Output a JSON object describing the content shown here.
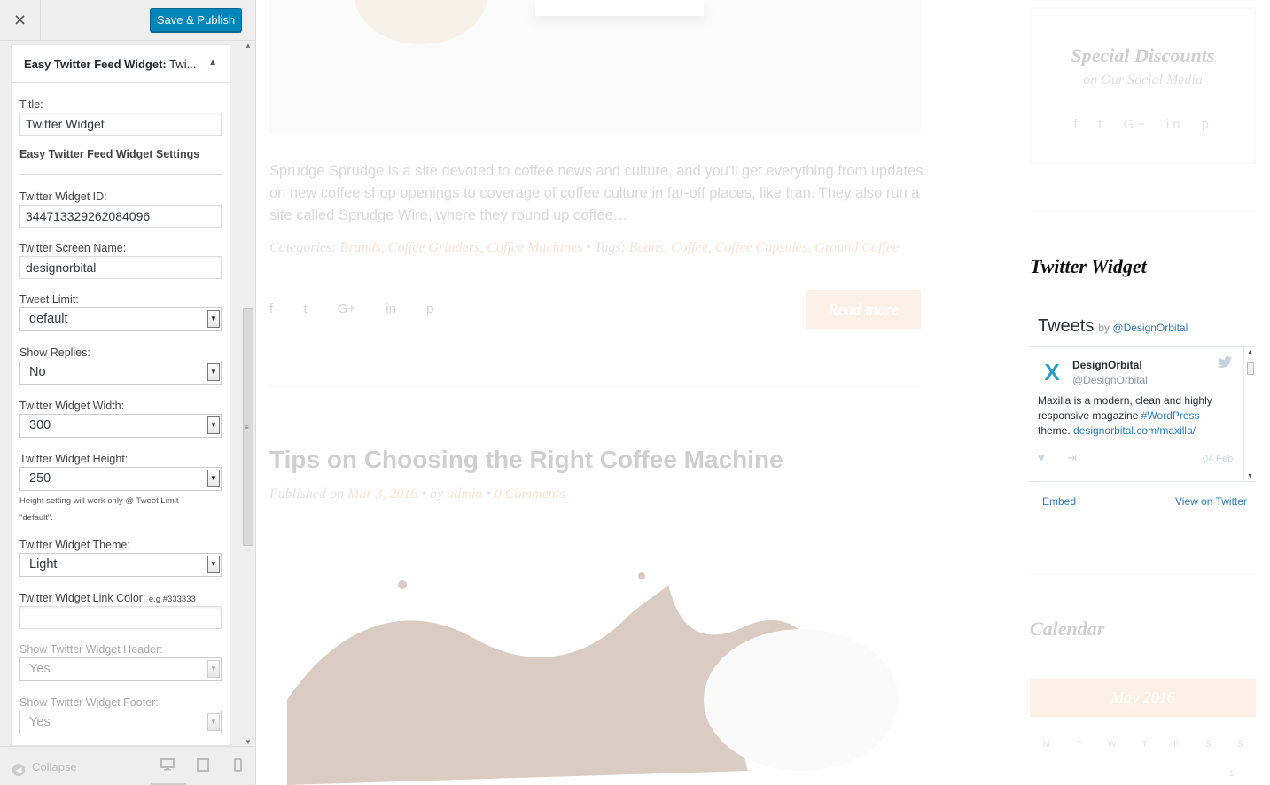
{
  "header": {
    "close_label": "×",
    "publish_label": "Save & Publish"
  },
  "widget": {
    "title_bold": "Easy Twitter Feed Widget:",
    "title_rest": " Twi...",
    "toggle_icon": "▲",
    "fields": {
      "title_label": "Title:",
      "title_value": "Twitter Widget",
      "settings_heading": "Easy Twitter Feed Widget Settings",
      "widget_id_label": "Twitter Widget ID:",
      "widget_id_value": "344713329262084096",
      "screen_name_label": "Twitter Screen Name:",
      "screen_name_value": "designorbital",
      "tweet_limit_label": "Tweet Limit:",
      "tweet_limit_value": "default",
      "show_replies_label": "Show Replies:",
      "show_replies_value": "No",
      "width_label": "Twitter Widget Width:",
      "width_value": "300",
      "height_label": "Twitter Widget Height:",
      "height_value": "250",
      "height_note_1": "Height setting will work only @ Tweet Limit",
      "height_note_2": "\"default\".",
      "theme_label": "Twitter Widget Theme:",
      "theme_value": "Light",
      "link_color_label": "Twitter Widget Link Color:",
      "link_color_hint": "e.g #333333",
      "link_color_value": "",
      "show_header_label": "Show Twitter Widget Header:",
      "show_header_value": "Yes",
      "show_footer_label": "Show Twitter Widget Footer:",
      "show_footer_value": "Yes"
    }
  },
  "footer": {
    "collapse_label": "Collapse",
    "collapse_icon": "◀",
    "devices": [
      "desktop-icon",
      "tablet-icon",
      "mobile-icon"
    ]
  },
  "preview": {
    "excerpt": "Sprudge Sprudge is a site devoted to coffee news and culture, and you'll get everything from updates on new coffee shop openings to coverage of coffee culture in far-off places, like Iran. They also run a site called Sprudge Wire, where they round up coffee…",
    "meta": {
      "categories_label": "Categories:",
      "categories": "Brands, Coffee Grinders, Coffee Machines",
      "sep": " • ",
      "tags_label": "Tags:",
      "tags": "Beans, Coffee, Coffee Capsules, Ground Coffee"
    },
    "share_icons": [
      "f",
      "t",
      "G+",
      "in",
      "p"
    ],
    "read_more": "Read more",
    "post2": {
      "title": "Tips on Choosing the Right Coffee Machine",
      "published_prefix": "Published on ",
      "date": "Mar 3, 2016",
      "by_prefix": " • by ",
      "author": "admin",
      "sep": " • ",
      "comments": "0 Comments"
    },
    "sidebar": {
      "special_title": "Special Discounts",
      "special_sub": "on Our Social Media",
      "twitter_widget_title": "Twitter Widget",
      "tweets_label": "Tweets",
      "by_label": "by",
      "by_handle": "@DesignOrbital",
      "tweet": {
        "name": "DesignOrbital",
        "handle": "@DesignOrbital",
        "text_1": "Maxilla is a modern, clean and highly responsive magazine ",
        "hashtag": "#WordPress",
        "text_2": " theme. ",
        "link": "designorbital.com/maxilla/",
        "date": "04 Feb"
      },
      "embed_label": "Embed",
      "view_label": "View on Twitter",
      "calendar_title": "Calendar",
      "calendar_month": "May 2016",
      "calendar_days": [
        "M",
        "T",
        "W",
        "T",
        "F",
        "S",
        "S"
      ],
      "calendar_cell": "1"
    }
  },
  "colors": {
    "publish": "#0085ba",
    "accent": "#e89a66",
    "twitter_link": "#2b7bb9"
  }
}
